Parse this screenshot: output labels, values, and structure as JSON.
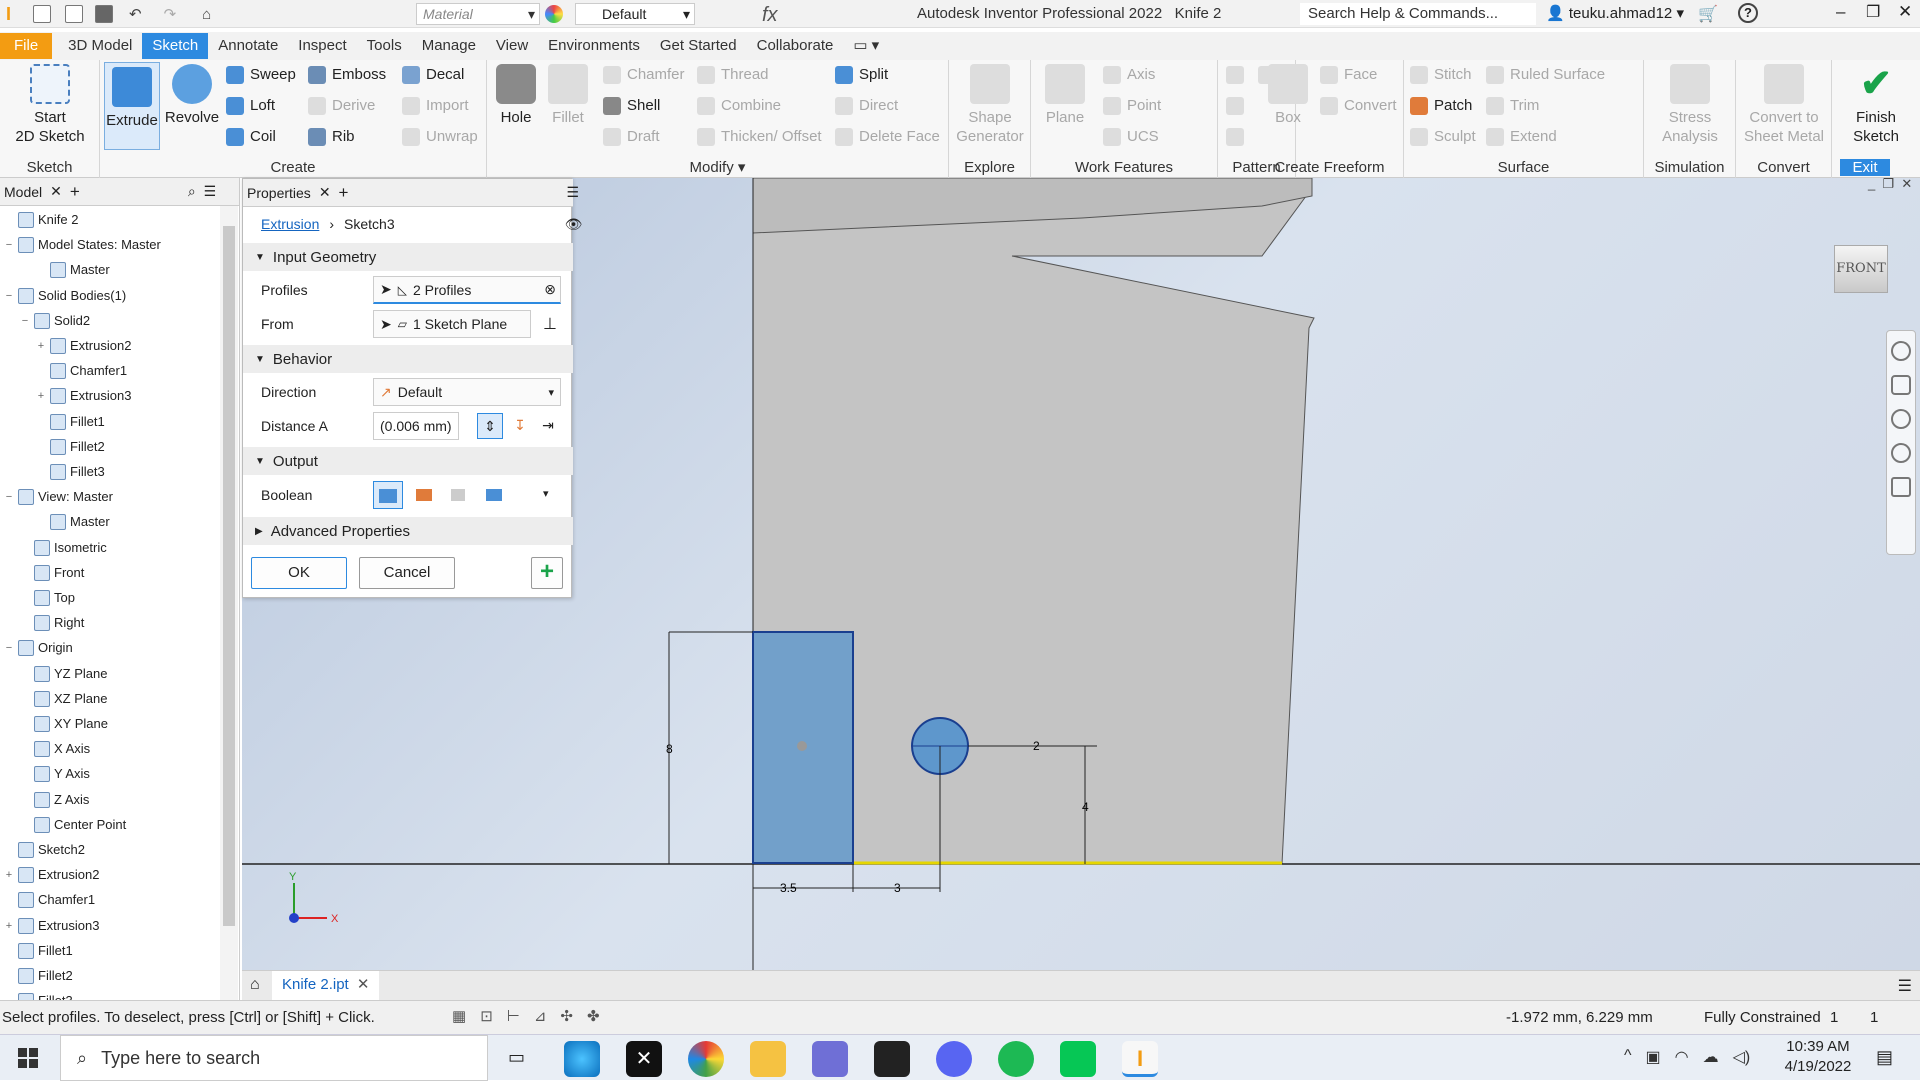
{
  "titlebar": {
    "material_placeholder": "Material",
    "appearance": "Default",
    "title": "Autodesk Inventor Professional 2022",
    "document": "Knife 2",
    "search": "Search Help & Commands...",
    "user": "teuku.ahmad12"
  },
  "ribbon_tabs": [
    "File",
    "3D Model",
    "Sketch",
    "Annotate",
    "Inspect",
    "Tools",
    "Manage",
    "View",
    "Environments",
    "Get Started",
    "Collaborate"
  ],
  "ribbon": {
    "sketch_panel": {
      "label": "Sketch",
      "start": "Start",
      "start2": "2D Sketch"
    },
    "create_panel": {
      "label": "Create",
      "extrude": "Extrude",
      "revolve": "Revolve",
      "sweep": "Sweep",
      "loft": "Loft",
      "coil": "Coil",
      "emboss": "Emboss",
      "derive": "Derive",
      "rib": "Rib",
      "decal": "Decal",
      "import": "Import",
      "unwrap": "Unwrap"
    },
    "modify_panel": {
      "label": "Modify",
      "hole": "Hole",
      "fillet": "Fillet",
      "chamfer": "Chamfer",
      "shell": "Shell",
      "draft": "Draft",
      "thread": "Thread",
      "combine": "Combine",
      "thicken": "Thicken/ Offset",
      "split": "Split",
      "direct": "Direct",
      "delete_face": "Delete Face"
    },
    "explore_panel": {
      "label": "Explore",
      "shape1": "Shape",
      "shape2": "Generator"
    },
    "work_panel": {
      "label": "Work Features",
      "plane": "Plane",
      "axis": "Axis",
      "point": "Point",
      "ucs": "UCS"
    },
    "pattern_panel": {
      "label": "Pattern"
    },
    "freeform_panel": {
      "label": "Create Freeform",
      "box": "Box",
      "face": "Face",
      "convert": "Convert"
    },
    "surface_panel": {
      "label": "Surface",
      "stitch": "Stitch",
      "patch": "Patch",
      "sculpt": "Sculpt",
      "ruled": "Ruled Surface",
      "trim": "Trim",
      "extend": "Extend"
    },
    "simulation_panel": {
      "label": "Simulation",
      "stress1": "Stress",
      "stress2": "Analysis"
    },
    "convert_panel": {
      "label": "Convert",
      "c1": "Convert to",
      "c2": "Sheet Metal"
    },
    "exit_panel": {
      "label": "Exit",
      "f1": "Finish",
      "f2": "Sketch"
    }
  },
  "browser": {
    "tab_label": "Model",
    "items": [
      {
        "label": "Knife 2",
        "depth": 0,
        "exp": ""
      },
      {
        "label": "Model States: Master",
        "depth": 0,
        "exp": "−"
      },
      {
        "label": "Master",
        "depth": 2,
        "exp": ""
      },
      {
        "label": "Solid Bodies(1)",
        "depth": 0,
        "exp": "−"
      },
      {
        "label": "Solid2",
        "depth": 1,
        "exp": "−"
      },
      {
        "label": "Extrusion2",
        "depth": 2,
        "exp": "+"
      },
      {
        "label": "Chamfer1",
        "depth": 2,
        "exp": ""
      },
      {
        "label": "Extrusion3",
        "depth": 2,
        "exp": "+"
      },
      {
        "label": "Fillet1",
        "depth": 2,
        "exp": ""
      },
      {
        "label": "Fillet2",
        "depth": 2,
        "exp": ""
      },
      {
        "label": "Fillet3",
        "depth": 2,
        "exp": ""
      },
      {
        "label": "View: Master",
        "depth": 0,
        "exp": "−"
      },
      {
        "label": "Master",
        "depth": 2,
        "exp": ""
      },
      {
        "label": "Isometric",
        "depth": 1,
        "exp": ""
      },
      {
        "label": "Front",
        "depth": 1,
        "exp": ""
      },
      {
        "label": "Top",
        "depth": 1,
        "exp": ""
      },
      {
        "label": "Right",
        "depth": 1,
        "exp": ""
      },
      {
        "label": "Origin",
        "depth": 0,
        "exp": "−"
      },
      {
        "label": "YZ Plane",
        "depth": 1,
        "exp": ""
      },
      {
        "label": "XZ Plane",
        "depth": 1,
        "exp": ""
      },
      {
        "label": "XY Plane",
        "depth": 1,
        "exp": ""
      },
      {
        "label": "X Axis",
        "depth": 1,
        "exp": ""
      },
      {
        "label": "Y Axis",
        "depth": 1,
        "exp": ""
      },
      {
        "label": "Z Axis",
        "depth": 1,
        "exp": ""
      },
      {
        "label": "Center Point",
        "depth": 1,
        "exp": ""
      },
      {
        "label": "Sketch2",
        "depth": 0,
        "exp": ""
      },
      {
        "label": "Extrusion2",
        "depth": 0,
        "exp": "+"
      },
      {
        "label": "Chamfer1",
        "depth": 0,
        "exp": ""
      },
      {
        "label": "Extrusion3",
        "depth": 0,
        "exp": "+"
      },
      {
        "label": "Fillet1",
        "depth": 0,
        "exp": ""
      },
      {
        "label": "Fillet2",
        "depth": 0,
        "exp": ""
      },
      {
        "label": "Fillet3",
        "depth": 0,
        "exp": ""
      }
    ]
  },
  "properties": {
    "tab_label": "Properties",
    "crumb_link": "Extrusion",
    "crumb_current": "Sketch3",
    "input_geometry": "Input Geometry",
    "profiles_label": "Profiles",
    "profiles_value": "2 Profiles",
    "from_label": "From",
    "from_value": "1 Sketch Plane",
    "behavior": "Behavior",
    "direction_label": "Direction",
    "direction_value": "Default",
    "distance_label": "Distance A",
    "distance_value": "(0.006 mm)",
    "output": "Output",
    "boolean_label": "Boolean",
    "advanced": "Advanced Properties",
    "ok": "OK",
    "cancel": "Cancel"
  },
  "viewport": {
    "viewcube": "FRONT",
    "dims": {
      "d1": "8",
      "d2": "2",
      "d3": "4",
      "d4": "3.5",
      "d5": "3"
    },
    "axis_x": "X",
    "axis_y": "Y"
  },
  "doc_tab": "Knife 2.ipt",
  "status": {
    "prompt": "Select profiles. To deselect, press [Ctrl] or [Shift] + Click.",
    "coords": "-1.972 mm, 6.229 mm",
    "constraint": "Fully Constrained",
    "n1": "1",
    "n2": "1"
  },
  "taskbar": {
    "search": "Type here to search",
    "time": "10:39 AM",
    "date": "4/19/2022"
  }
}
